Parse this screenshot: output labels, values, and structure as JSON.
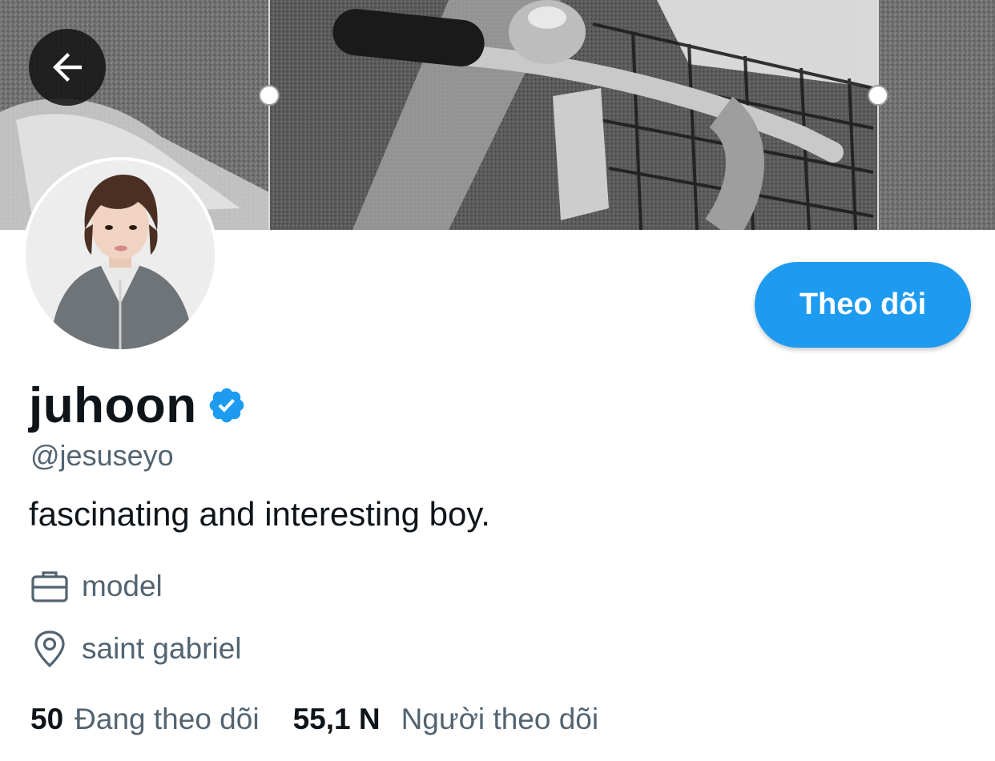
{
  "header": {
    "back_icon": "arrow-left-icon"
  },
  "profile": {
    "display_name": "juhoon",
    "verified_icon": "verified-badge-icon",
    "handle": "@jesuseyo",
    "bio": "fascinating and interesting boy.",
    "follow_label": "Theo dõi",
    "accent_color": "#1d9bf0"
  },
  "meta": {
    "profession_icon": "briefcase-icon",
    "profession": "model",
    "location_icon": "location-pin-icon",
    "location": "saint gabriel"
  },
  "stats": {
    "following_count": "50",
    "following_label": "Đang theo dõi",
    "followers_count": "55,1 N",
    "followers_label": "Người theo dõi"
  }
}
